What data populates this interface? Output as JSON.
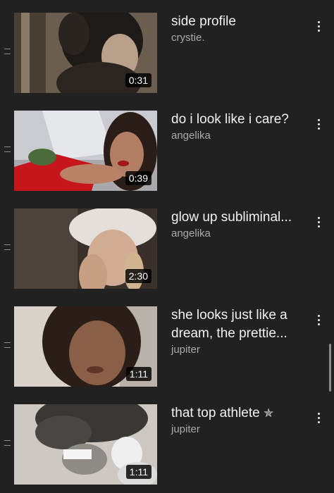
{
  "playlist": {
    "items": [
      {
        "title": "side profile",
        "channel": "crystie.",
        "duration": "0:31"
      },
      {
        "title": "do i look like i care?",
        "channel": "angelika",
        "duration": "0:39"
      },
      {
        "title": "glow up subliminal...",
        "channel": "angelika",
        "duration": "2:30"
      },
      {
        "title": "she looks just like a dream, the prettie...",
        "channel": "jupiter",
        "duration": "1:11"
      },
      {
        "title": "that top athlete",
        "title_suffix": "✯",
        "channel": "jupiter",
        "duration": "1:11"
      }
    ]
  },
  "icons": {
    "drag": "drag-handle-icon",
    "more": "more-vert-icon",
    "star": "star-icon"
  },
  "colors": {
    "background": "#212121",
    "title": "#f1f1f1",
    "subtitle": "#aaaaaa"
  }
}
